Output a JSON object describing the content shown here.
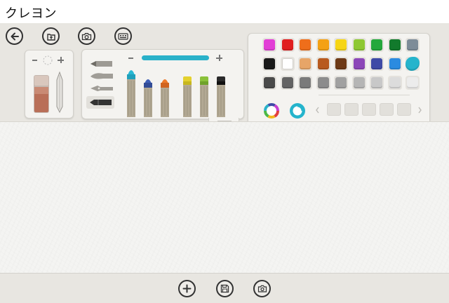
{
  "app": {
    "title": "クレヨン"
  },
  "toolbar": {
    "icons": [
      "back-arrow-icon",
      "import-folder-icon",
      "camera-icon",
      "keyboard-icon"
    ]
  },
  "size_panel": {
    "minus_label": "−",
    "plus_label": "+"
  },
  "tool_panel": {
    "brushes": [
      "pencil-brush-icon",
      "ink-brush-icon",
      "pen-nib-icon",
      "crayon-brush-icon"
    ],
    "selected_brush": "crayon-brush-icon",
    "crayon_colors": [
      "#28b8d4",
      "#3f5fb6",
      "#ee7a2a",
      "#e4d12e",
      "#8ac13a",
      "#2a2a2a"
    ],
    "size_slider_color": "#2ab1c9",
    "size_slider_value": 1.0
  },
  "color_panel": {
    "row1": [
      "#e23fd6",
      "#e01f1f",
      "#ef6e1b",
      "#f4a114",
      "#f6d513",
      "#8ec832",
      "#24a83c",
      "#127a2c",
      "#7d8c98"
    ],
    "row2": [
      "#1a1a1a",
      "#ffffff",
      "#e7a568",
      "#b85a1e",
      "#6e3a16",
      "#8c47b8",
      "#3e4aa6",
      "#2b8be0",
      "#25b4cc"
    ],
    "row3": [
      "#4a4a4a",
      "#636363",
      "#7a7a7a",
      "#8c8c8c",
      "#a1a1a1",
      "#b5b5b5",
      "#c8c8c8",
      "#dcdcdc",
      "#ececec"
    ],
    "selected_color": "#25b4cc",
    "custom_slots": 5,
    "icons": [
      "color-wheel-icon",
      "eyedropper-icon",
      "chevron-left-icon",
      "chevron-right-icon"
    ]
  },
  "bottom_bar": {
    "icons": [
      "add-icon",
      "save-icon",
      "share-camera-icon"
    ]
  }
}
